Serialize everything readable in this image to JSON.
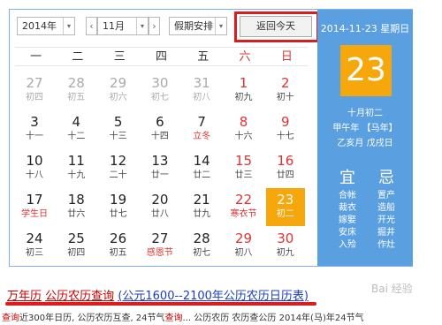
{
  "toolbar": {
    "year": "2014年",
    "month": "11月",
    "holiday": "假期安排",
    "today_button": "返回今天",
    "prev": "‹",
    "next": "›",
    "arrow": "▾"
  },
  "weekdays": [
    "一",
    "二",
    "三",
    "四",
    "五",
    "六",
    "日"
  ],
  "weeks": [
    [
      {
        "d": "27",
        "l": "初四",
        "other": true
      },
      {
        "d": "28",
        "l": "初五",
        "other": true
      },
      {
        "d": "29",
        "l": "初六",
        "other": true
      },
      {
        "d": "30",
        "l": "初七",
        "other": true
      },
      {
        "d": "31",
        "l": "初八",
        "other": true
      },
      {
        "d": "1",
        "l": "初九",
        "wk": true
      },
      {
        "d": "2",
        "l": "初十",
        "wk": true
      }
    ],
    [
      {
        "d": "3",
        "l": "十一"
      },
      {
        "d": "4",
        "l": "十二"
      },
      {
        "d": "5",
        "l": "十三"
      },
      {
        "d": "6",
        "l": "十四"
      },
      {
        "d": "7",
        "l": "立冬",
        "hl": true
      },
      {
        "d": "8",
        "l": "十六",
        "wk": true
      },
      {
        "d": "9",
        "l": "十七",
        "wk": true
      }
    ],
    [
      {
        "d": "10",
        "l": "十八"
      },
      {
        "d": "11",
        "l": "十九"
      },
      {
        "d": "12",
        "l": "二十"
      },
      {
        "d": "13",
        "l": "廿一"
      },
      {
        "d": "14",
        "l": "廿二"
      },
      {
        "d": "15",
        "l": "廿三",
        "wk": true
      },
      {
        "d": "16",
        "l": "廿四",
        "wk": true
      }
    ],
    [
      {
        "d": "17",
        "l": "学生日",
        "hl": true
      },
      {
        "d": "18",
        "l": "廿六"
      },
      {
        "d": "19",
        "l": "廿七"
      },
      {
        "d": "20",
        "l": "廿八"
      },
      {
        "d": "21",
        "l": "廿九"
      },
      {
        "d": "22",
        "l": "寒衣节",
        "wk": true,
        "hl": true
      },
      {
        "d": "23",
        "l": "初二",
        "today": true
      }
    ],
    [
      {
        "d": "24",
        "l": "初三"
      },
      {
        "d": "25",
        "l": "初四"
      },
      {
        "d": "26",
        "l": "初五"
      },
      {
        "d": "27",
        "l": "感恩节",
        "hl": true
      },
      {
        "d": "28",
        "l": "初七"
      },
      {
        "d": "29",
        "l": "初八",
        "wk": true
      },
      {
        "d": "30",
        "l": "初九",
        "wk": true
      }
    ]
  ],
  "side": {
    "date": "2014-11-23 星期日",
    "day": "23",
    "lunar": "十月初二",
    "year_gz": "甲午年 【马年】",
    "month_day_gz": "乙亥月 戊戌日",
    "yi": "宜",
    "ji": "忌",
    "yi_items": [
      "合帐",
      "裁衣",
      "嫁娶",
      "安床",
      "入殓"
    ],
    "ji_items": [
      "置产",
      "造船",
      "开光",
      "掘井",
      "作灶"
    ]
  },
  "result": {
    "title_a": "万年历",
    "title_b": "公历农历查询",
    "title_c": "(公元1600--2100年公历农历日历表)",
    "snippet": [
      {
        "t": "查询",
        "r": true
      },
      {
        "t": "近300年日历, 公历农历互查, 24节气"
      },
      {
        "t": "查询",
        "r": true
      },
      {
        "t": "... 公历农历 农历查公历 2014年(马)年24节气"
      }
    ]
  },
  "watermark": "Bai 经验"
}
